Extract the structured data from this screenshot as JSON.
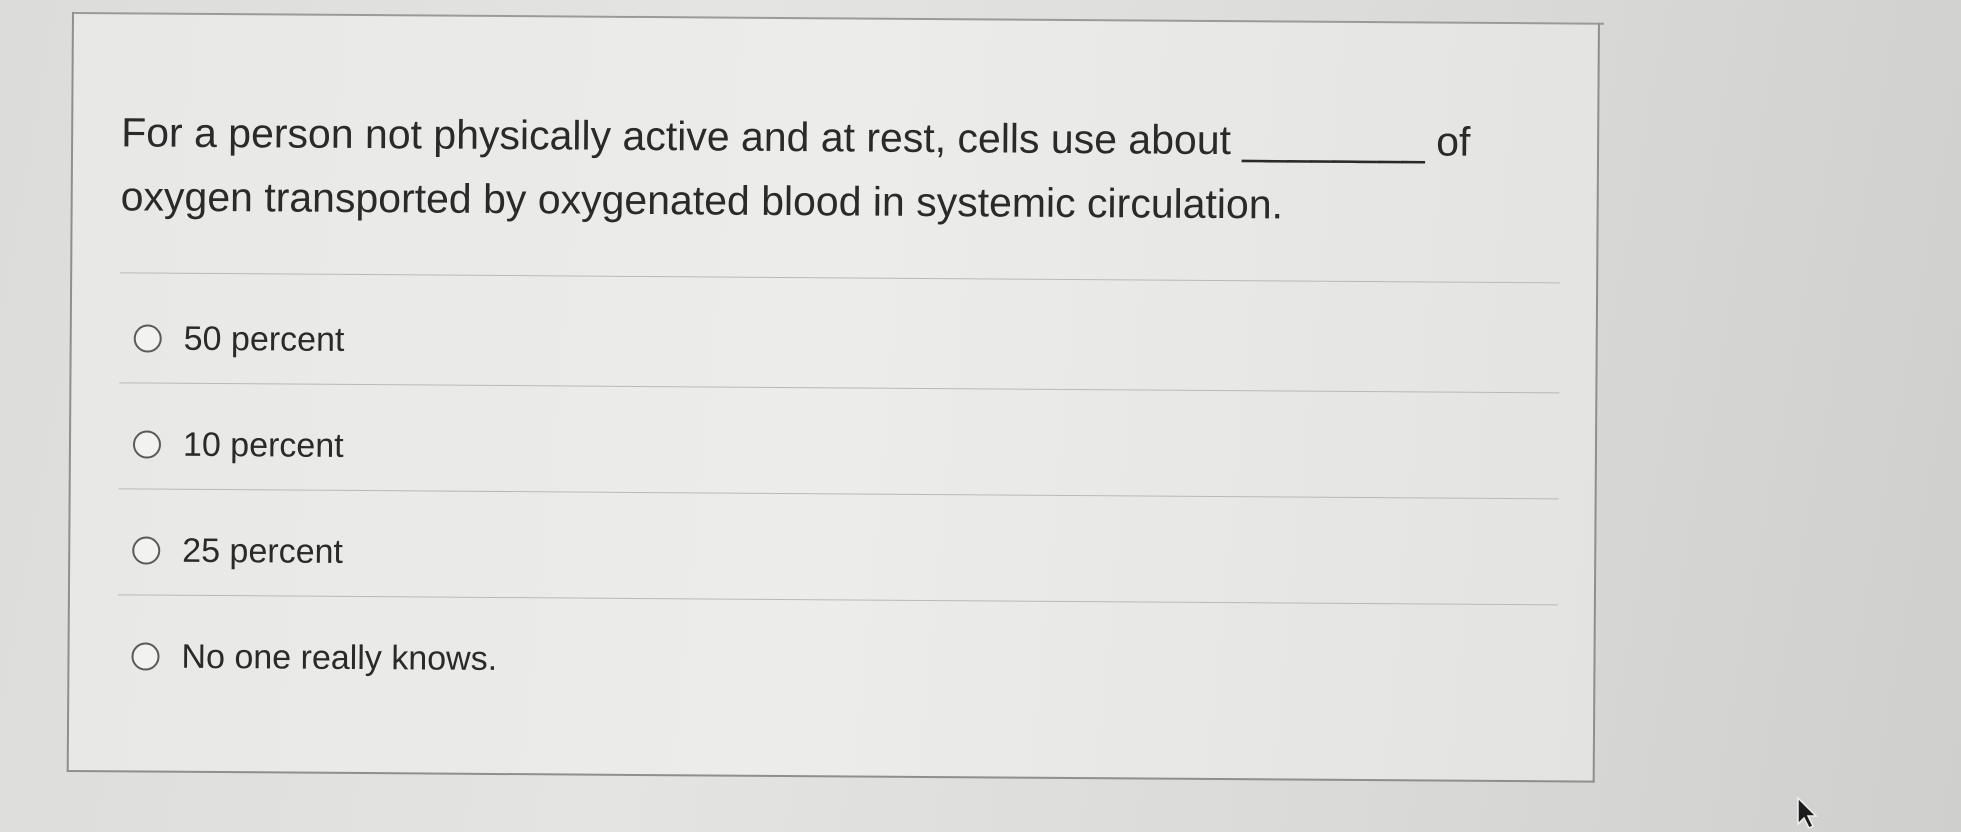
{
  "question": {
    "text": "For a person not physically active and at rest, cells use about ________ of oxygen transported by oxygenated blood in systemic circulation."
  },
  "options": [
    {
      "label": "50 percent"
    },
    {
      "label": "10 percent"
    },
    {
      "label": "25 percent"
    },
    {
      "label": "No one really knows."
    }
  ],
  "icons": {
    "radio": "radio-unselected-icon",
    "cursor": "mouse-pointer-icon"
  }
}
